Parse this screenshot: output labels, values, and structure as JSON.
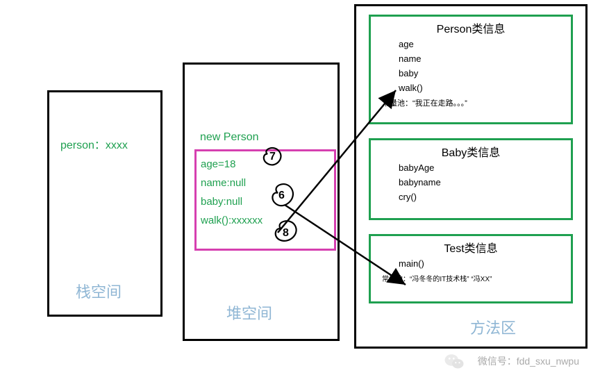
{
  "stack": {
    "var": "person：xxxx",
    "label": "栈空间"
  },
  "heap": {
    "title": "new Person",
    "fields": {
      "age": "age=18",
      "name": "name:null",
      "baby": "baby:null",
      "walk": "walk():xxxxxx"
    },
    "label": "堆空间"
  },
  "methodArea": {
    "label": "方法区",
    "person": {
      "title": "Person类信息",
      "fields": {
        "age": "age",
        "name": "name",
        "baby": "baby",
        "walk": "walk()"
      },
      "constPool": "常量池：“我正在走路。。。”"
    },
    "baby": {
      "title": "Baby类信息",
      "fields": {
        "babyAge": "babyAge",
        "babyname": "babyname",
        "cry": "cry()"
      }
    },
    "test": {
      "title": "Test类信息",
      "fields": {
        "main": "main()"
      },
      "constPool": "常量池：“冯冬冬的IT技术栈” “冯XX”"
    }
  },
  "annotations": {
    "num7": "7",
    "num6": "6",
    "num8": "8"
  },
  "watermark": "微信号：fdd_sxu_nwpu"
}
